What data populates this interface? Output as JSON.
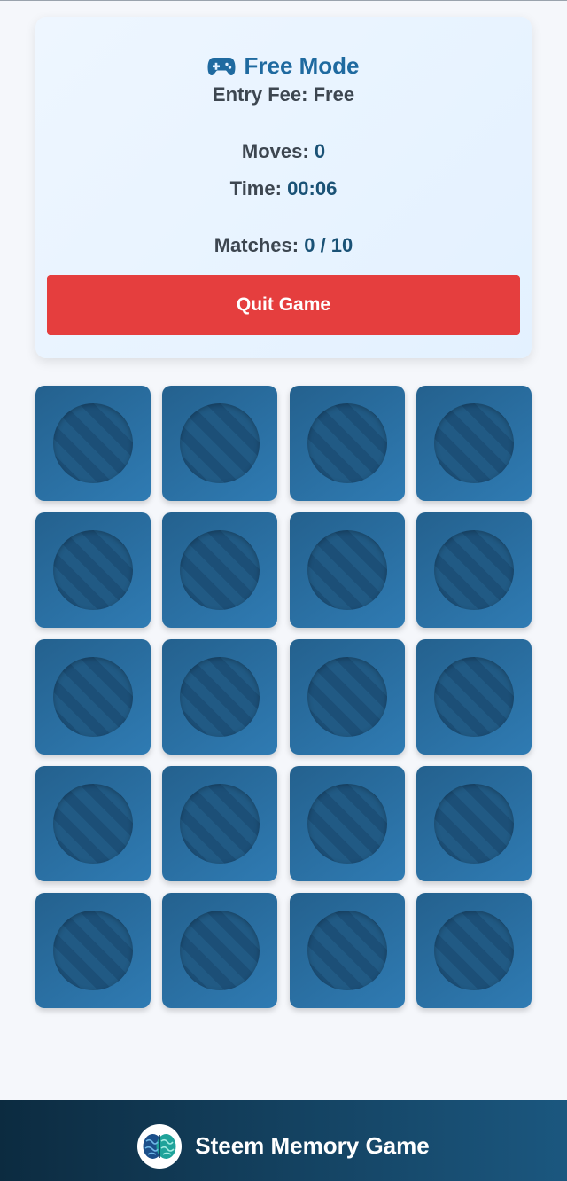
{
  "mode": {
    "title": "Free Mode",
    "icon": "gamepad-icon"
  },
  "stats": {
    "entry_fee_label": "Entry Fee:",
    "entry_fee_value": "Free",
    "moves_label": "Moves:",
    "moves_value": "0",
    "time_label": "Time:",
    "time_value": "00:06",
    "matches_label": "Matches:",
    "matches_value": "0 / 10"
  },
  "actions": {
    "quit_label": "Quit Game"
  },
  "board": {
    "rows": 5,
    "cols": 4,
    "card_state": "face-down"
  },
  "footer": {
    "title": "Steem Memory Game",
    "logo_icon": "brain-icon"
  },
  "colors": {
    "accent": "#1f6aa0",
    "quit_button": "#e53e3e",
    "card_back": "#2a6fa3",
    "footer_start": "#0c2b40",
    "footer_end": "#1b577f"
  }
}
